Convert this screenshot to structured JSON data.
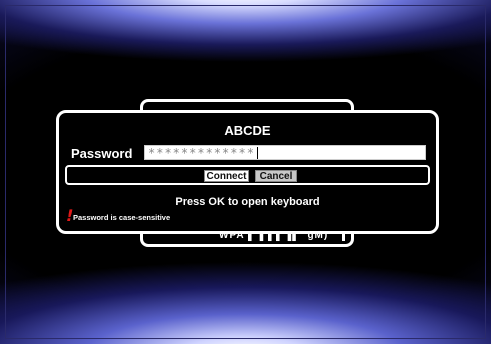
{
  "dialog": {
    "title": "ABCDE",
    "password_label": "Password",
    "password_value": "*************",
    "connect_label": "Connect",
    "cancel_label": "Cancel",
    "hint": "Press OK to open keyboard",
    "warning_icon": "!",
    "warning": "Password is case-sensitive"
  },
  "background_panel": {
    "row_text": "WPA ▌▐ ▌▌▐▌ 'gM)"
  },
  "colors": {
    "background": "#000000",
    "glow": "#6a72d8",
    "warning": "#e01818",
    "button_active": "#ffffff",
    "button_inactive": "#c8c8c8"
  }
}
